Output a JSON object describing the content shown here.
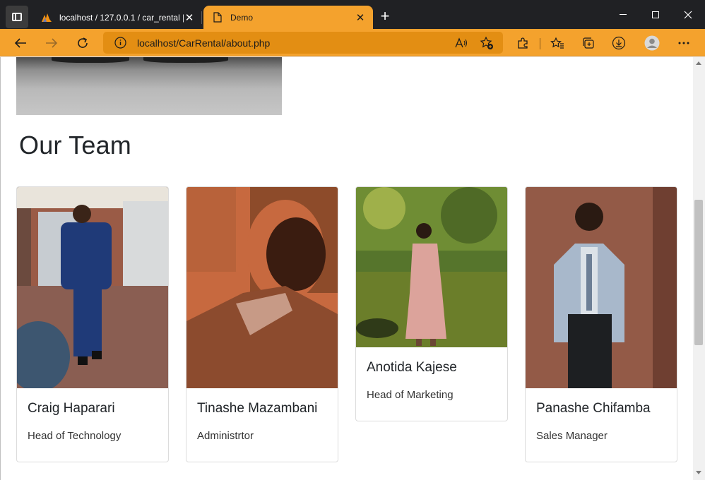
{
  "browser": {
    "tabs": [
      {
        "title": "localhost / 127.0.0.1 / car_rental |",
        "active": false,
        "icon": "phpmyadmin-icon"
      },
      {
        "title": "Demo",
        "active": true,
        "icon": "page-icon"
      }
    ],
    "address_url": "localhost/CarRental/about.php",
    "theme_color": "#f4a22d"
  },
  "page": {
    "heading": "Our Team",
    "team": [
      {
        "name": "Craig Haparari",
        "role": "Head of Technology"
      },
      {
        "name": "Tinashe Mazambani",
        "role": "Administrtor"
      },
      {
        "name": "Anotida Kajese",
        "role": "Head of Marketing"
      },
      {
        "name": "Panashe Chifamba",
        "role": "Sales Manager"
      }
    ]
  }
}
